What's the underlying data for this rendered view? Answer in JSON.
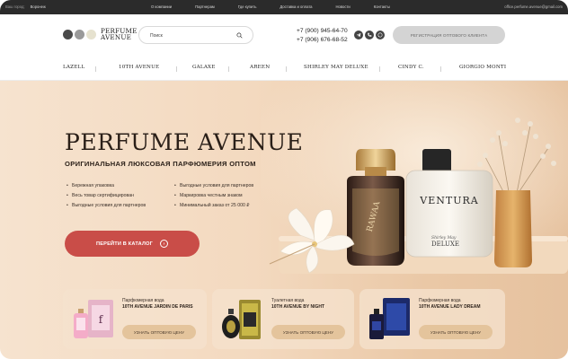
{
  "topbar": {
    "city_label": "Ваш город:",
    "city": "Воронеж",
    "nav": [
      "О компании",
      "Партнерам",
      "Где купить",
      "Доставка и оплата",
      "Новости",
      "Контакты"
    ],
    "email": "office.perfume.avenue@gmail.com"
  },
  "header": {
    "logo_line1": "PERFUME",
    "logo_line2": "AVENUE",
    "logo_colors": [
      "#4a4a4a",
      "#9a9a9a",
      "#e6e2cf"
    ],
    "search_placeholder": "Поиск",
    "phone1": "+7 (900) 945-64-70",
    "phone2": "+7 (906) 676-68-52",
    "messengers": [
      "telegram-icon",
      "viber-icon",
      "whatsapp-icon"
    ],
    "register_label": "РЕГИСТРАЦИЯ ОПТОВОГО КЛИЕНТА"
  },
  "brands": [
    "LAZELL",
    "10TH AVENUE",
    "GALAXE",
    "AREEN",
    "SHIRLEY MAY DELUXE",
    "CINDY C.",
    "GIORGIO MONTI"
  ],
  "hero": {
    "title": "PERFUME AVENUE",
    "subtitle": "ОРИГИНАЛЬНАЯ ЛЮКСОВАЯ ПАРФЮМЕРИЯ ОПТОМ",
    "features_left": [
      "Бережная упаковка",
      "Весь товар сертифицирован",
      "Выгодные условия для партнеров"
    ],
    "features_right": [
      "Выгодные условия для партнеров",
      "Маркировка честным знаком",
      "Минимальный заказ от 25 000 ₽"
    ],
    "cta_label": "ПЕРЕЙТИ В КАТАЛОГ",
    "bottle1_label": "RAWAA",
    "bottle2_label": "VENTURA",
    "bottle3_line1": "Shirley May",
    "bottle3_line2": "DELUXE",
    "accent": "#c94d48"
  },
  "products": [
    {
      "type": "Парфюмерная вода",
      "name": "10TH AVENUE JARDIN DE PARIS",
      "button": "УЗНАТЬ ОПТОВУЮ ЦЕНУ"
    },
    {
      "type": "Туалетная вода",
      "name": "10TH AVENUE BY NIGHT",
      "button": "УЗНАТЬ ОПТОВУЮ ЦЕНУ"
    },
    {
      "type": "Парфюмерная вода",
      "name": "10TH AVENUE LADY DREAM",
      "button": "УЗНАТЬ ОПТОВУЮ ЦЕНУ"
    }
  ]
}
